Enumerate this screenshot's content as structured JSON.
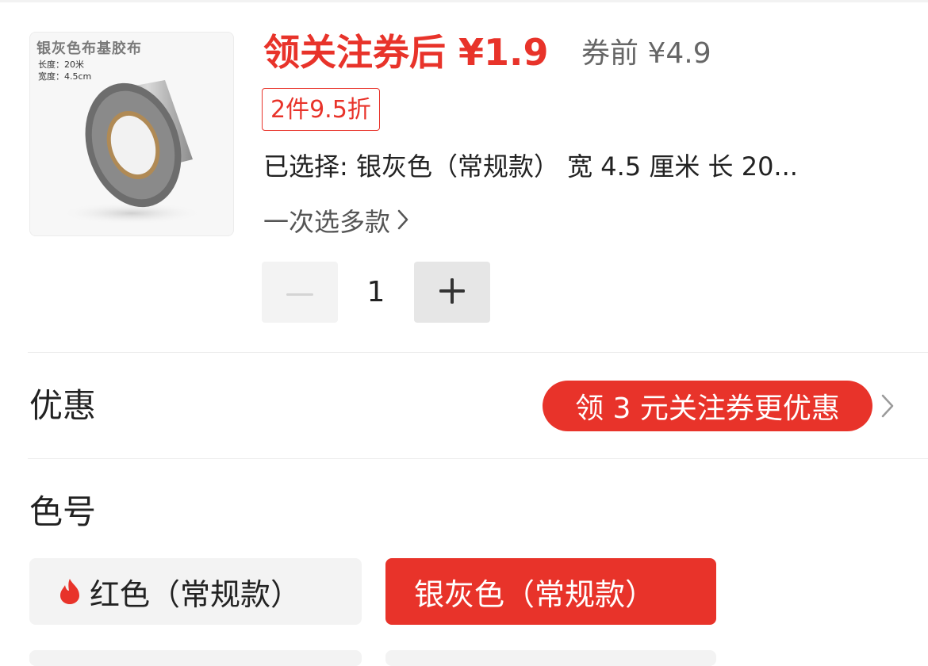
{
  "product": {
    "image_title": "银灰色布基胶布",
    "image_spec_length": "长度：20米",
    "image_spec_width": "宽度：4.5cm"
  },
  "price": {
    "coupon_price": "领关注券后 ¥1.9",
    "original_price": "券前 ¥4.9"
  },
  "discount_badge": "2件9.5折",
  "selected": "已选择: 银灰色（常规款） 宽 4.5 厘米 长 20...",
  "multi_select": "一次选多款",
  "quantity": {
    "value": "1",
    "minus_icon": "minus-icon",
    "plus_icon": "plus-icon"
  },
  "promo": {
    "label": "优惠",
    "pill_text": "领 3 元关注券更优惠"
  },
  "color": {
    "label": "色号",
    "options": [
      {
        "label": "红色（常规款）",
        "icon": "flame-icon",
        "selected": false
      },
      {
        "label": "银灰色（常规款）",
        "selected": true
      }
    ]
  },
  "colors": {
    "accent": "#e8332a",
    "muted_bg": "#f3f3f3"
  }
}
